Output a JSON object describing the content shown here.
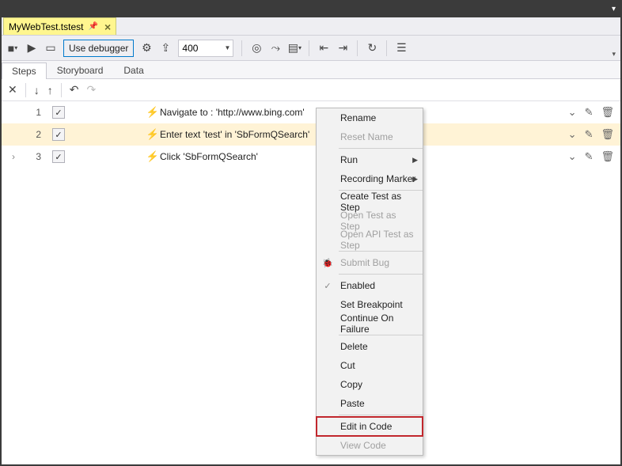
{
  "titlebar": {
    "caret": "▾"
  },
  "filetab": {
    "name": "MyWebTest.tstest",
    "pin": "📌",
    "close": "×"
  },
  "toolbar": {
    "debugger_label": "Use debugger",
    "speed": "400"
  },
  "subtabs": {
    "steps": "Steps",
    "storyboard": "Storyboard",
    "data": "Data"
  },
  "stepbar": {
    "close": "✕",
    "down": "↓",
    "up": "↑",
    "undo": "↶",
    "redo": "↷"
  },
  "steps": [
    {
      "num": "1",
      "desc": "Navigate to : 'http://www.bing.com'"
    },
    {
      "num": "2",
      "desc": "Enter text 'test' in 'SbFormQSearch'"
    },
    {
      "num": "3",
      "desc": "Click 'SbFormQSearch'"
    }
  ],
  "rowicons": {
    "expand": "⌄",
    "edit": "✎",
    "del": "🗑"
  },
  "menu": {
    "rename": "Rename",
    "reset": "Reset Name",
    "run": "Run",
    "marker": "Recording Marker",
    "create_step": "Create Test as Step",
    "open_step": "Open Test as Step",
    "open_api": "Open API Test as Step",
    "submit_bug": "Submit Bug",
    "enabled": "Enabled",
    "breakpoint": "Set Breakpoint",
    "continue": "Continue On Failure",
    "delete": "Delete",
    "cut": "Cut",
    "copy": "Copy",
    "paste": "Paste",
    "edit_code": "Edit in Code",
    "view_code": "View Code"
  }
}
